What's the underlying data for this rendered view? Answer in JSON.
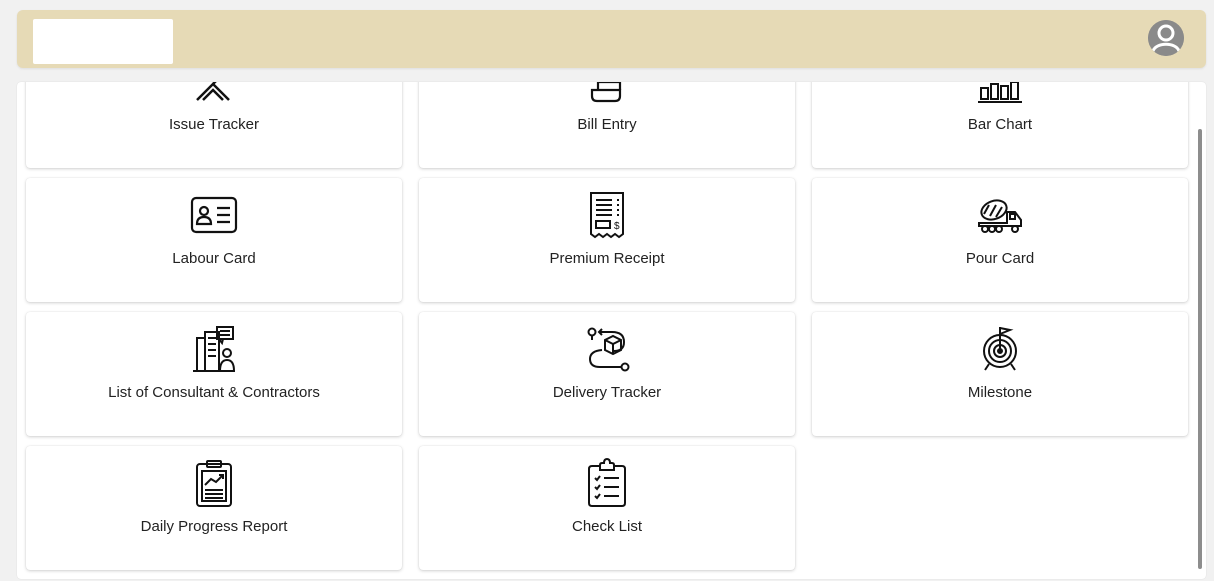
{
  "header": {
    "avatar_icon": "user-avatar-icon"
  },
  "tiles": [
    {
      "label": "Issue Tracker",
      "icon": "issue-tracker-icon"
    },
    {
      "label": "Bill Entry",
      "icon": "bill-entry-icon"
    },
    {
      "label": "Bar Chart",
      "icon": "bar-chart-icon"
    },
    {
      "label": "Labour Card",
      "icon": "id-card-icon"
    },
    {
      "label": "Premium Receipt",
      "icon": "receipt-icon"
    },
    {
      "label": "Pour Card",
      "icon": "concrete-mixer-truck-icon"
    },
    {
      "label": "List of Consultant & Contractors",
      "icon": "building-contractors-icon"
    },
    {
      "label": "Delivery Tracker",
      "icon": "delivery-route-icon"
    },
    {
      "label": "Milestone",
      "icon": "target-flag-icon"
    },
    {
      "label": "Daily Progress Report",
      "icon": "progress-report-icon"
    },
    {
      "label": "Check List",
      "icon": "checklist-clipboard-icon"
    }
  ],
  "colors": {
    "header_bg": "#e6dab6",
    "page_bg": "#f1f1f1",
    "card_bg": "#ffffff"
  }
}
